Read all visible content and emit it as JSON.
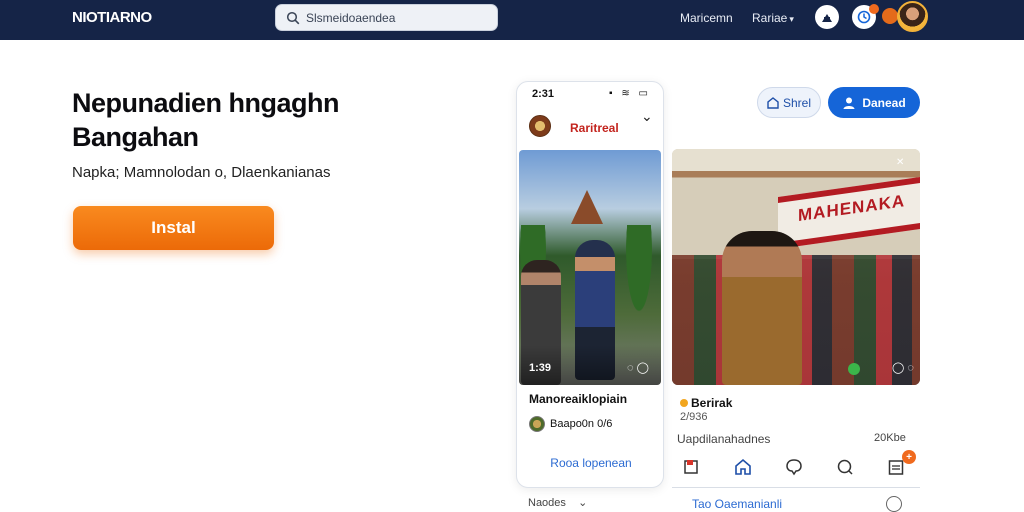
{
  "nav": {
    "logo": "NIOTIARNO",
    "search_placeholder": "Slsmeidoaendea",
    "links": [
      "Maricemn",
      "Rariae"
    ]
  },
  "hero": {
    "title": "Nepunadien hngaghn Bangahan",
    "subtitle": "Napka; Mamnolodan o, Dlaenkanianas",
    "install_label": "Instal"
  },
  "phone": {
    "time": "2:31",
    "channel_name": "Raritreal",
    "duration": "1:39",
    "caption": "Manoreaiklopiain",
    "username": "Baapo0n 0/6",
    "link": "Rooa lopenean",
    "below_label": "Naodes"
  },
  "actions_top": {
    "share_label": "Shrel",
    "follow_label": "Danead"
  },
  "main_video": {
    "banner_text": "MAHENAKA",
    "author": "Berirak",
    "count": "2/936",
    "description": "Uapdilanahadnes",
    "views": "20Kbe",
    "bottom_link": "Tao Oaemanianli"
  },
  "colors": {
    "nav_bg": "#152447",
    "install": "#f47b12",
    "follow": "#1565d8",
    "link": "#2c6bd2",
    "accent_badge": "#f06a1e"
  },
  "icons": [
    "search-icon",
    "user-icon",
    "bell-icon",
    "share-icon",
    "more-icon",
    "like-icon",
    "home-icon",
    "comment-icon",
    "search-action-icon",
    "bookmark-icon"
  ]
}
